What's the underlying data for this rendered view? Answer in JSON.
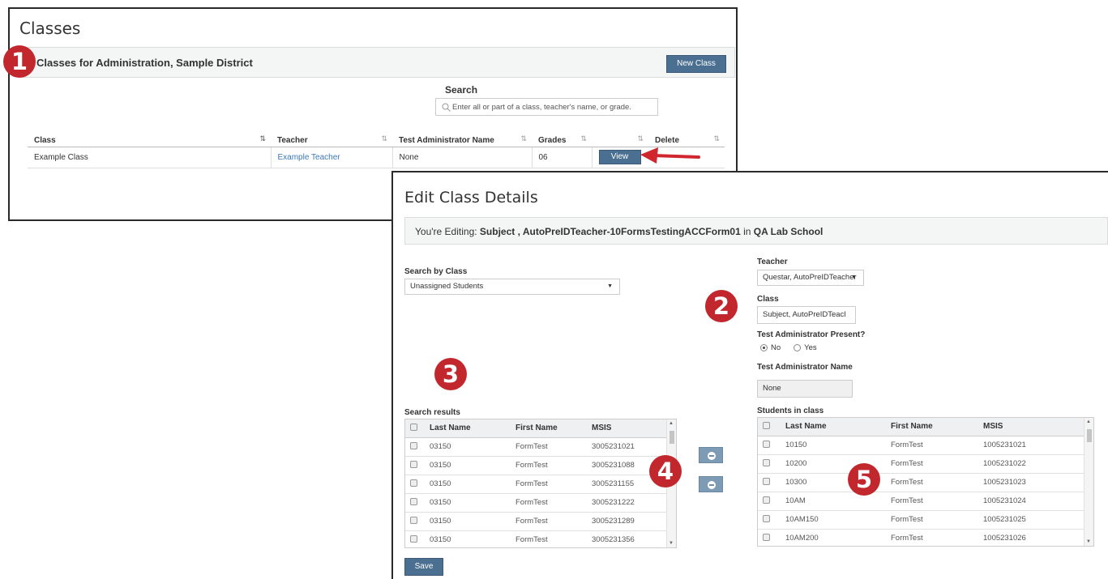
{
  "classes_panel": {
    "title": "Classes",
    "banner": "Classes for Administration, Sample District",
    "new_class_label": "New Class",
    "search_label": "Search",
    "search_placeholder": "Enter all or part of a class, teacher's name, or grade.",
    "columns": [
      "Class",
      "Teacher",
      "Test Administrator Name",
      "Grades",
      "",
      "Delete"
    ],
    "rows": [
      {
        "class": "Example Class",
        "teacher": "Example Teacher",
        "admin": "None",
        "grades": "06",
        "action": "View"
      }
    ]
  },
  "edit_panel": {
    "title": "Edit Class Details",
    "editing_prefix": "You're Editing:",
    "editing_subject": "Subject , AutoPreIDTeacher-10FormsTestingACCForm01",
    "editing_in": "in",
    "editing_school": "QA Lab School",
    "search_by_class_label": "Search by Class",
    "search_by_class_value": "Unassigned Students",
    "teacher_label": "Teacher",
    "teacher_value": "Questar, AutoPreIDTeacher",
    "class_label": "Class",
    "class_value": "Subject, AutoPreIDTeacl",
    "admin_present_label": "Test Administrator Present?",
    "radio_no": "No",
    "radio_yes": "Yes",
    "radio_selected": "No",
    "admin_name_label": "Test Administrator Name",
    "admin_name_value": "None",
    "search_results_label": "Search results",
    "search_results_columns": [
      "Last Name",
      "First Name",
      "MSIS"
    ],
    "search_results": [
      [
        "03150",
        "FormTest",
        "3005231021"
      ],
      [
        "03150",
        "FormTest",
        "3005231088"
      ],
      [
        "03150",
        "FormTest",
        "3005231155"
      ],
      [
        "03150",
        "FormTest",
        "3005231222"
      ],
      [
        "03150",
        "FormTest",
        "3005231289"
      ],
      [
        "03150",
        "FormTest",
        "3005231356"
      ]
    ],
    "students_label": "Students in class",
    "students_columns": [
      "Last Name",
      "First Name",
      "MSIS"
    ],
    "students": [
      [
        "10150",
        "FormTest",
        "1005231021"
      ],
      [
        "10200",
        "FormTest",
        "1005231022"
      ],
      [
        "10300",
        "FormTest",
        "1005231023"
      ],
      [
        "10AM",
        "FormTest",
        "1005231024"
      ],
      [
        "10AM150",
        "FormTest",
        "1005231025"
      ],
      [
        "10AM200",
        "FormTest",
        "1005231026"
      ]
    ],
    "save_label": "Save"
  },
  "markers": [
    "1",
    "2",
    "3",
    "4",
    "5"
  ],
  "colors": {
    "button": "#4a6f90",
    "marker": "#c1272d",
    "link": "#3a78b5",
    "move_button": "#7d9bb5"
  },
  "icons": [
    "search-icon",
    "sort-icon",
    "arrow-right-icon",
    "arrow-left-icon",
    "dropdown-caret-icon"
  ]
}
